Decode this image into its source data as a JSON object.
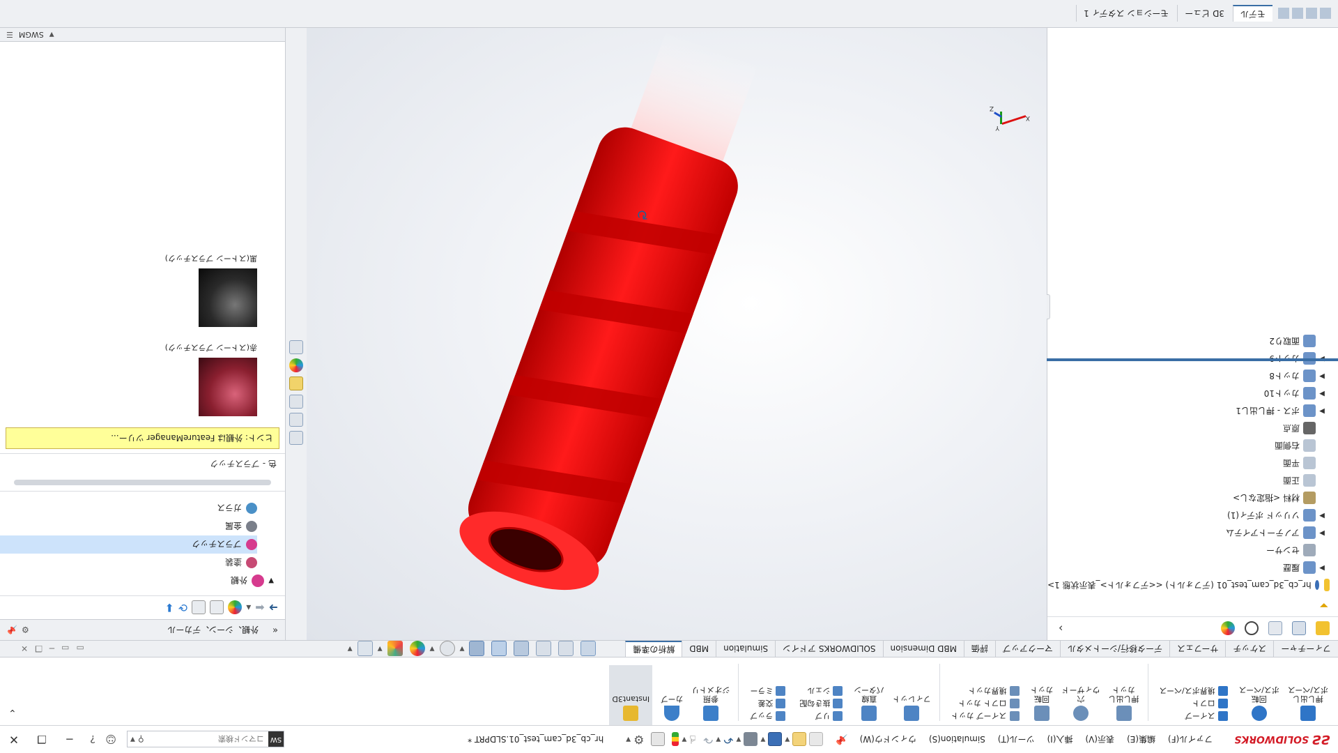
{
  "title_bar": {
    "logo_text": "SOLIDWORKS",
    "menus": [
      "ファイル(F)",
      "編集(E)",
      "表示(V)",
      "挿入(I)",
      "ツール(T)",
      "Simulation(S)",
      "ウィンドウ(W)"
    ],
    "document_title": "hr_cb_3d_cam_test_01.SLDPRT *",
    "search_placeholder": "コマンド検索"
  },
  "command_manager": {
    "tabs": [
      "フィーチャー",
      "スケッチ",
      "マークアップ",
      "評価",
      "MBD Dimension",
      "SOLIDWORKS アドイン",
      "Simulation",
      "MBD",
      "解析の準備"
    ],
    "extra_tab_left": "サーフェス",
    "extra_tab_mid": "データ移行/シートメタル",
    "commands": [
      {
        "label": "押し出し\nボス/ベース"
      },
      {
        "label": "回転\nボス/ベース"
      },
      {
        "label": "スイープ"
      },
      {
        "label": "ロフト"
      },
      {
        "label": "境界ボス/ベース"
      },
      {
        "label": "押し出し\nカット"
      },
      {
        "label": "穴\nウィザード"
      },
      {
        "label": "回転\nカット"
      },
      {
        "label": "スイープ カット"
      },
      {
        "label": "ロフト カット"
      },
      {
        "label": "境界カット"
      },
      {
        "label": "フィレット"
      },
      {
        "label": "直線\nパターン"
      },
      {
        "label": "リブ"
      },
      {
        "label": "抜き勾配"
      },
      {
        "label": "シェル"
      },
      {
        "label": "ラップ"
      },
      {
        "label": "交差"
      },
      {
        "label": "ミラー"
      },
      {
        "label": "参照\nジオメトリ"
      },
      {
        "label": "カーブ"
      },
      {
        "label": "Instant3D"
      }
    ]
  },
  "panel_header": {
    "title": "外観、シーン、デカール",
    "menu_label": "モデル",
    "tab_3d": "3D ビュー",
    "tab_motion": "モーション スタディ 1"
  },
  "feature_tree": {
    "root": "hr_cb_3d_cam_test_01 (デフォルト) <<デフォルト>_表示状態 1>",
    "items": [
      {
        "label": "履歴",
        "expandable": true
      },
      {
        "label": "センサー",
        "expandable": false
      },
      {
        "label": "アノテートアイテム",
        "expandable": true
      },
      {
        "label": "ソリッド ボディ(1)",
        "expandable": true
      },
      {
        "label": "材料 <指定なし>",
        "expandable": false
      },
      {
        "label": "正面",
        "expandable": false
      },
      {
        "label": "平面",
        "expandable": false
      },
      {
        "label": "右側面",
        "expandable": false
      },
      {
        "label": "原点",
        "expandable": false
      },
      {
        "label": "ボス - 押し出し1",
        "expandable": true
      },
      {
        "label": "カット10",
        "expandable": true
      },
      {
        "label": "カット8",
        "expandable": true
      },
      {
        "label": "カット9",
        "expandable": true
      },
      {
        "label": "面取り2",
        "expandable": false
      }
    ]
  },
  "appearances": {
    "tree": [
      {
        "label": "外観",
        "color": "#d63b8e"
      },
      {
        "label": "塗装",
        "color": "#c74a74"
      },
      {
        "label": "プラスチック",
        "color": "#d63b8e",
        "selected": true
      },
      {
        "label": "金属",
        "color": "#7a7f8a"
      },
      {
        "label": "ガラス",
        "color": "#4a90c7"
      }
    ],
    "tooltip": "ヒント: 外観は FeatureManager ツリー...",
    "section_label": "色 - プラスチック",
    "swatches": [
      {
        "label": "赤(ストーン プラスチック)",
        "color": "#8a1f2f"
      },
      {
        "label": "黒(ストーン プラスチック)",
        "color": "#2a2a2a"
      }
    ]
  },
  "viewport": {
    "triad_x": "X",
    "triad_y": "Y",
    "triad_z": "Z",
    "rotate_icon": "rotate-icon"
  },
  "colors": {
    "model_red": "#ff0000",
    "accent_blue": "#3a6ea5",
    "tooltip_yellow": "#ffff99",
    "solidworks_red": "#d31b26"
  }
}
